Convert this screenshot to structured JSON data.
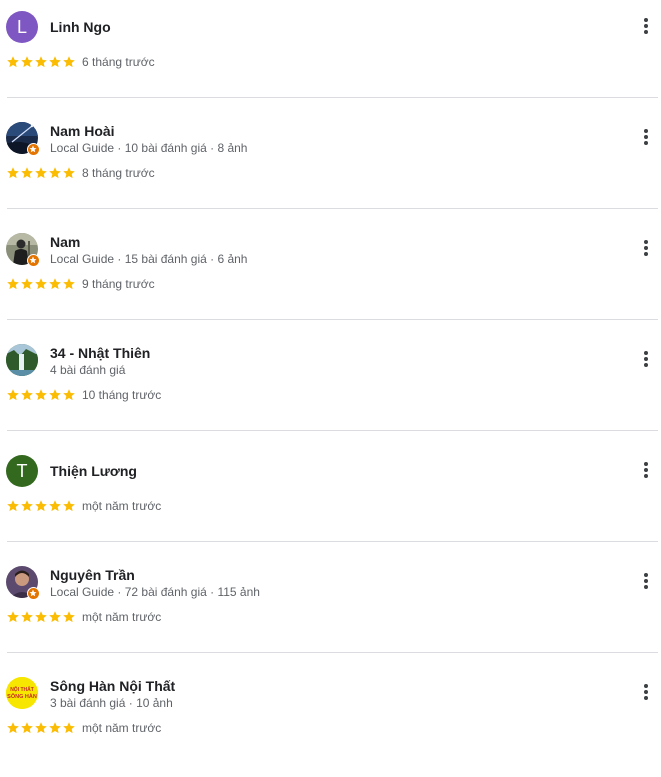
{
  "colors": {
    "star": "#fbbc04",
    "divider": "#dadce0",
    "meta_text": "#5f6368",
    "name_text": "#202124",
    "local_guide_badge": "#e37400"
  },
  "reviews": [
    {
      "name": "Linh Ngo",
      "meta": "",
      "rating": 5,
      "date": "6 tháng trước",
      "avatar": {
        "type": "letter",
        "letter": "L",
        "color": "#7e57c2"
      },
      "local_guide": false
    },
    {
      "name": "Nam Hoài",
      "meta": "Local Guide · 10 bài đánh giá · 8 ảnh",
      "rating": 5,
      "date": "8 tháng trước",
      "avatar": {
        "type": "photo",
        "icon": "night-sky-photo"
      },
      "local_guide": true
    },
    {
      "name": "Nam",
      "meta": "Local Guide · 15 bài đánh giá · 6 ảnh",
      "rating": 5,
      "date": "9 tháng trước",
      "avatar": {
        "type": "photo",
        "icon": "person-photo"
      },
      "local_guide": true
    },
    {
      "name": "34 - Nhật Thiên",
      "meta": "4 bài đánh giá",
      "rating": 5,
      "date": "10 tháng trước",
      "avatar": {
        "type": "photo",
        "icon": "waterfall-photo"
      },
      "local_guide": false
    },
    {
      "name": "Thiện Lương",
      "meta": "",
      "rating": 5,
      "date": "một năm trước",
      "avatar": {
        "type": "letter",
        "letter": "T",
        "color": "#33691e"
      },
      "local_guide": false
    },
    {
      "name": "Nguyên Trần",
      "meta": "Local Guide · 72 bài đánh giá · 115 ảnh",
      "rating": 5,
      "date": "một năm trước",
      "avatar": {
        "type": "photo",
        "icon": "portrait-photo"
      },
      "local_guide": true
    },
    {
      "name": "Sông Hàn Nội Thất",
      "meta": "3 bài đánh giá · 10 ảnh",
      "rating": 5,
      "date": "một năm trước",
      "avatar": {
        "type": "logo",
        "icon": "song-han-logo",
        "logo_text_top": "NỘI THẤT",
        "logo_text_bottom": "SÔNG HÀN"
      },
      "local_guide": false
    }
  ]
}
